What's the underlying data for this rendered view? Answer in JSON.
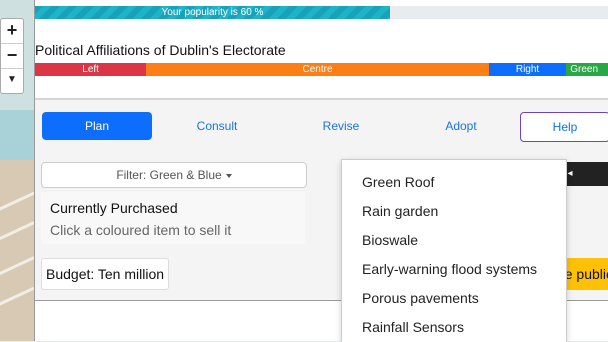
{
  "map": {
    "zoom_in": "+",
    "zoom_out": "−",
    "reset": "▼"
  },
  "popularity": {
    "text": "Your popularity is 60 %",
    "value_percent": 60,
    "color": "#17a2b8"
  },
  "affiliations": {
    "title": "Political Affiliations of Dublin's Electorate",
    "segments": [
      {
        "label": "Left",
        "color": "#dc3545"
      },
      {
        "label": "Centre",
        "color": "#fd7e14"
      },
      {
        "label": "Right",
        "color": "#0d6efd"
      },
      {
        "label": "Green",
        "color": "#28a745"
      }
    ]
  },
  "tabs": {
    "plan": "Plan",
    "consult": "Consult",
    "revise": "Revise",
    "adopt": "Adopt",
    "help": "Help"
  },
  "filter": {
    "label": "Filter: Green & Blue"
  },
  "dark_button": {
    "icon": "◂"
  },
  "purchased": {
    "heading": "Currently Purchased",
    "hint": "Click a coloured item to sell it"
  },
  "budget": {
    "label": "Budget: Ten million"
  },
  "consult_button": {
    "label": "Consult the public"
  },
  "dropdown": {
    "items": [
      "Green Roof",
      "Rain garden",
      "Bioswale",
      "Early-warning flood systems",
      "Porous pavements",
      "Rainfall Sensors"
    ]
  }
}
